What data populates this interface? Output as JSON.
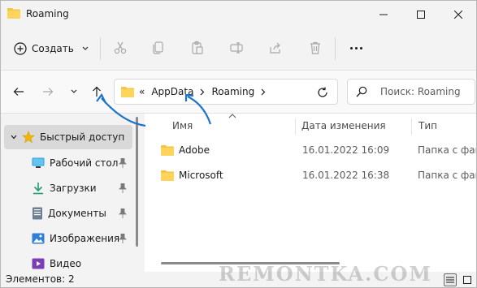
{
  "window": {
    "title": "Roaming"
  },
  "commandbar": {
    "create_label": "Создать",
    "icons": [
      "cut-icon",
      "copy-icon",
      "paste-icon",
      "rename-icon",
      "share-icon",
      "delete-icon",
      "more-icon"
    ]
  },
  "address": {
    "overflow": "«",
    "crumbs": [
      "AppData",
      "Roaming"
    ]
  },
  "search": {
    "placeholder": "Поиск: Roaming"
  },
  "sidebar": {
    "items": [
      {
        "label": "Быстрый доступ",
        "icon": "star-icon",
        "selected": true
      },
      {
        "label": "Рабочий стол",
        "icon": "desktop-icon",
        "pinned": true
      },
      {
        "label": "Загрузки",
        "icon": "download-icon",
        "pinned": true
      },
      {
        "label": "Документы",
        "icon": "documents-icon",
        "pinned": true
      },
      {
        "label": "Изображения",
        "icon": "pictures-icon",
        "pinned": true
      },
      {
        "label": "Видео",
        "icon": "video-icon"
      }
    ]
  },
  "columns": {
    "name": "Имя",
    "date": "Дата изменения",
    "type": "Тип"
  },
  "files": [
    {
      "name": "Adobe",
      "date": "16.01.2022 16:09",
      "type": "Папка с фай"
    },
    {
      "name": "Microsoft",
      "date": "16.01.2022 16:38",
      "type": "Папка с фай"
    }
  ],
  "status": {
    "text": "Элементов: 2"
  },
  "watermark": "REMONTKA.COM",
  "colors": {
    "accent": "#0067c0",
    "folder": "#f5c542",
    "annotation_arrow": "#1e73c8"
  }
}
